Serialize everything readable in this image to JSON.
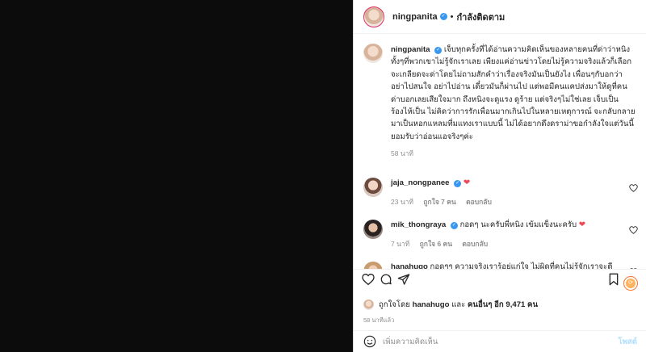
{
  "header": {
    "username": "ningpanita",
    "follow_label": "กำลังติดตาม"
  },
  "caption": {
    "username": "ningpanita",
    "text": "เจ็บทุกครั้งที่ได้อ่านความคิดเห็นของหลายคนที่ด่าว่าหนิง ทั้งๆที่พวกเขาไม่รู้จักเราเลย เพียงแค่อ่านข่าวโดยไม่รู้ความจริงแล้วก็เลือกจะเกลียดจะด่าโดยไม่ถามสักคำว่าเรื่องจริงมันเป็นยังไง เพื่อนๆกับอกว่า อย่าไปสนใจ อย่าไปอ่าน เดี๋ยวมันก็ผ่านไป แต่พอมีคนแคปส่งมาให้ดูที่คนด่าบอกเลยเสียใจมาก ถึงหนิงจะดูแรง ดูร้าย แต่จริงๆไม่ใช่เลย เจ็บเป็น ร้องไห้เป็น ไม่คิดว่าการรักเพื่อนมากเกินไปในหลายเหตุการณ์ จะกลับกลายมาเป็นหอกแหลมที่มแทงเราแบบนี้ ไม่ได้อยากดึงดราม่าขอกำลังใจแต่วันนี้ยอมรับว่าอ่อนแอจริงๆค่ะ",
    "time": "58 นาที"
  },
  "comments": [
    {
      "username": "jaja_nongpanee",
      "text": "",
      "time": "23 นาที",
      "likes": "ถูกใจ 7 คน",
      "reply": "ตอบกลับ"
    },
    {
      "username": "mik_thongraya",
      "text": "กอดๆ นะครับพี่หนิง เข้มแข็งนะครับ",
      "time": "7 นาที",
      "likes": "ถูกใจ 6 คน",
      "reply": "ตอบกลับ"
    },
    {
      "username": "hanahugo",
      "text": "กอดๆๆ ความจริงเรารู้อยู่แก่ใจ ไม่ผิดที่คนไม่รู้จักเราจะตี",
      "time": "",
      "likes": "",
      "reply": ""
    }
  ],
  "likes_line": {
    "prefix": "ถูกใจโดย",
    "user": "hanahugo",
    "joiner": "และ",
    "others": "คนอื่นๆ อีก 9,471 คน"
  },
  "post_time": "58 นาทีแล้ว",
  "add_comment": {
    "placeholder": "เพิ่มความคิดเห็น",
    "post_label": "โพสต์"
  },
  "colors": {
    "verified": "#3897f0",
    "heart": "#ed4956",
    "link_disabled": "#b2dffc"
  }
}
